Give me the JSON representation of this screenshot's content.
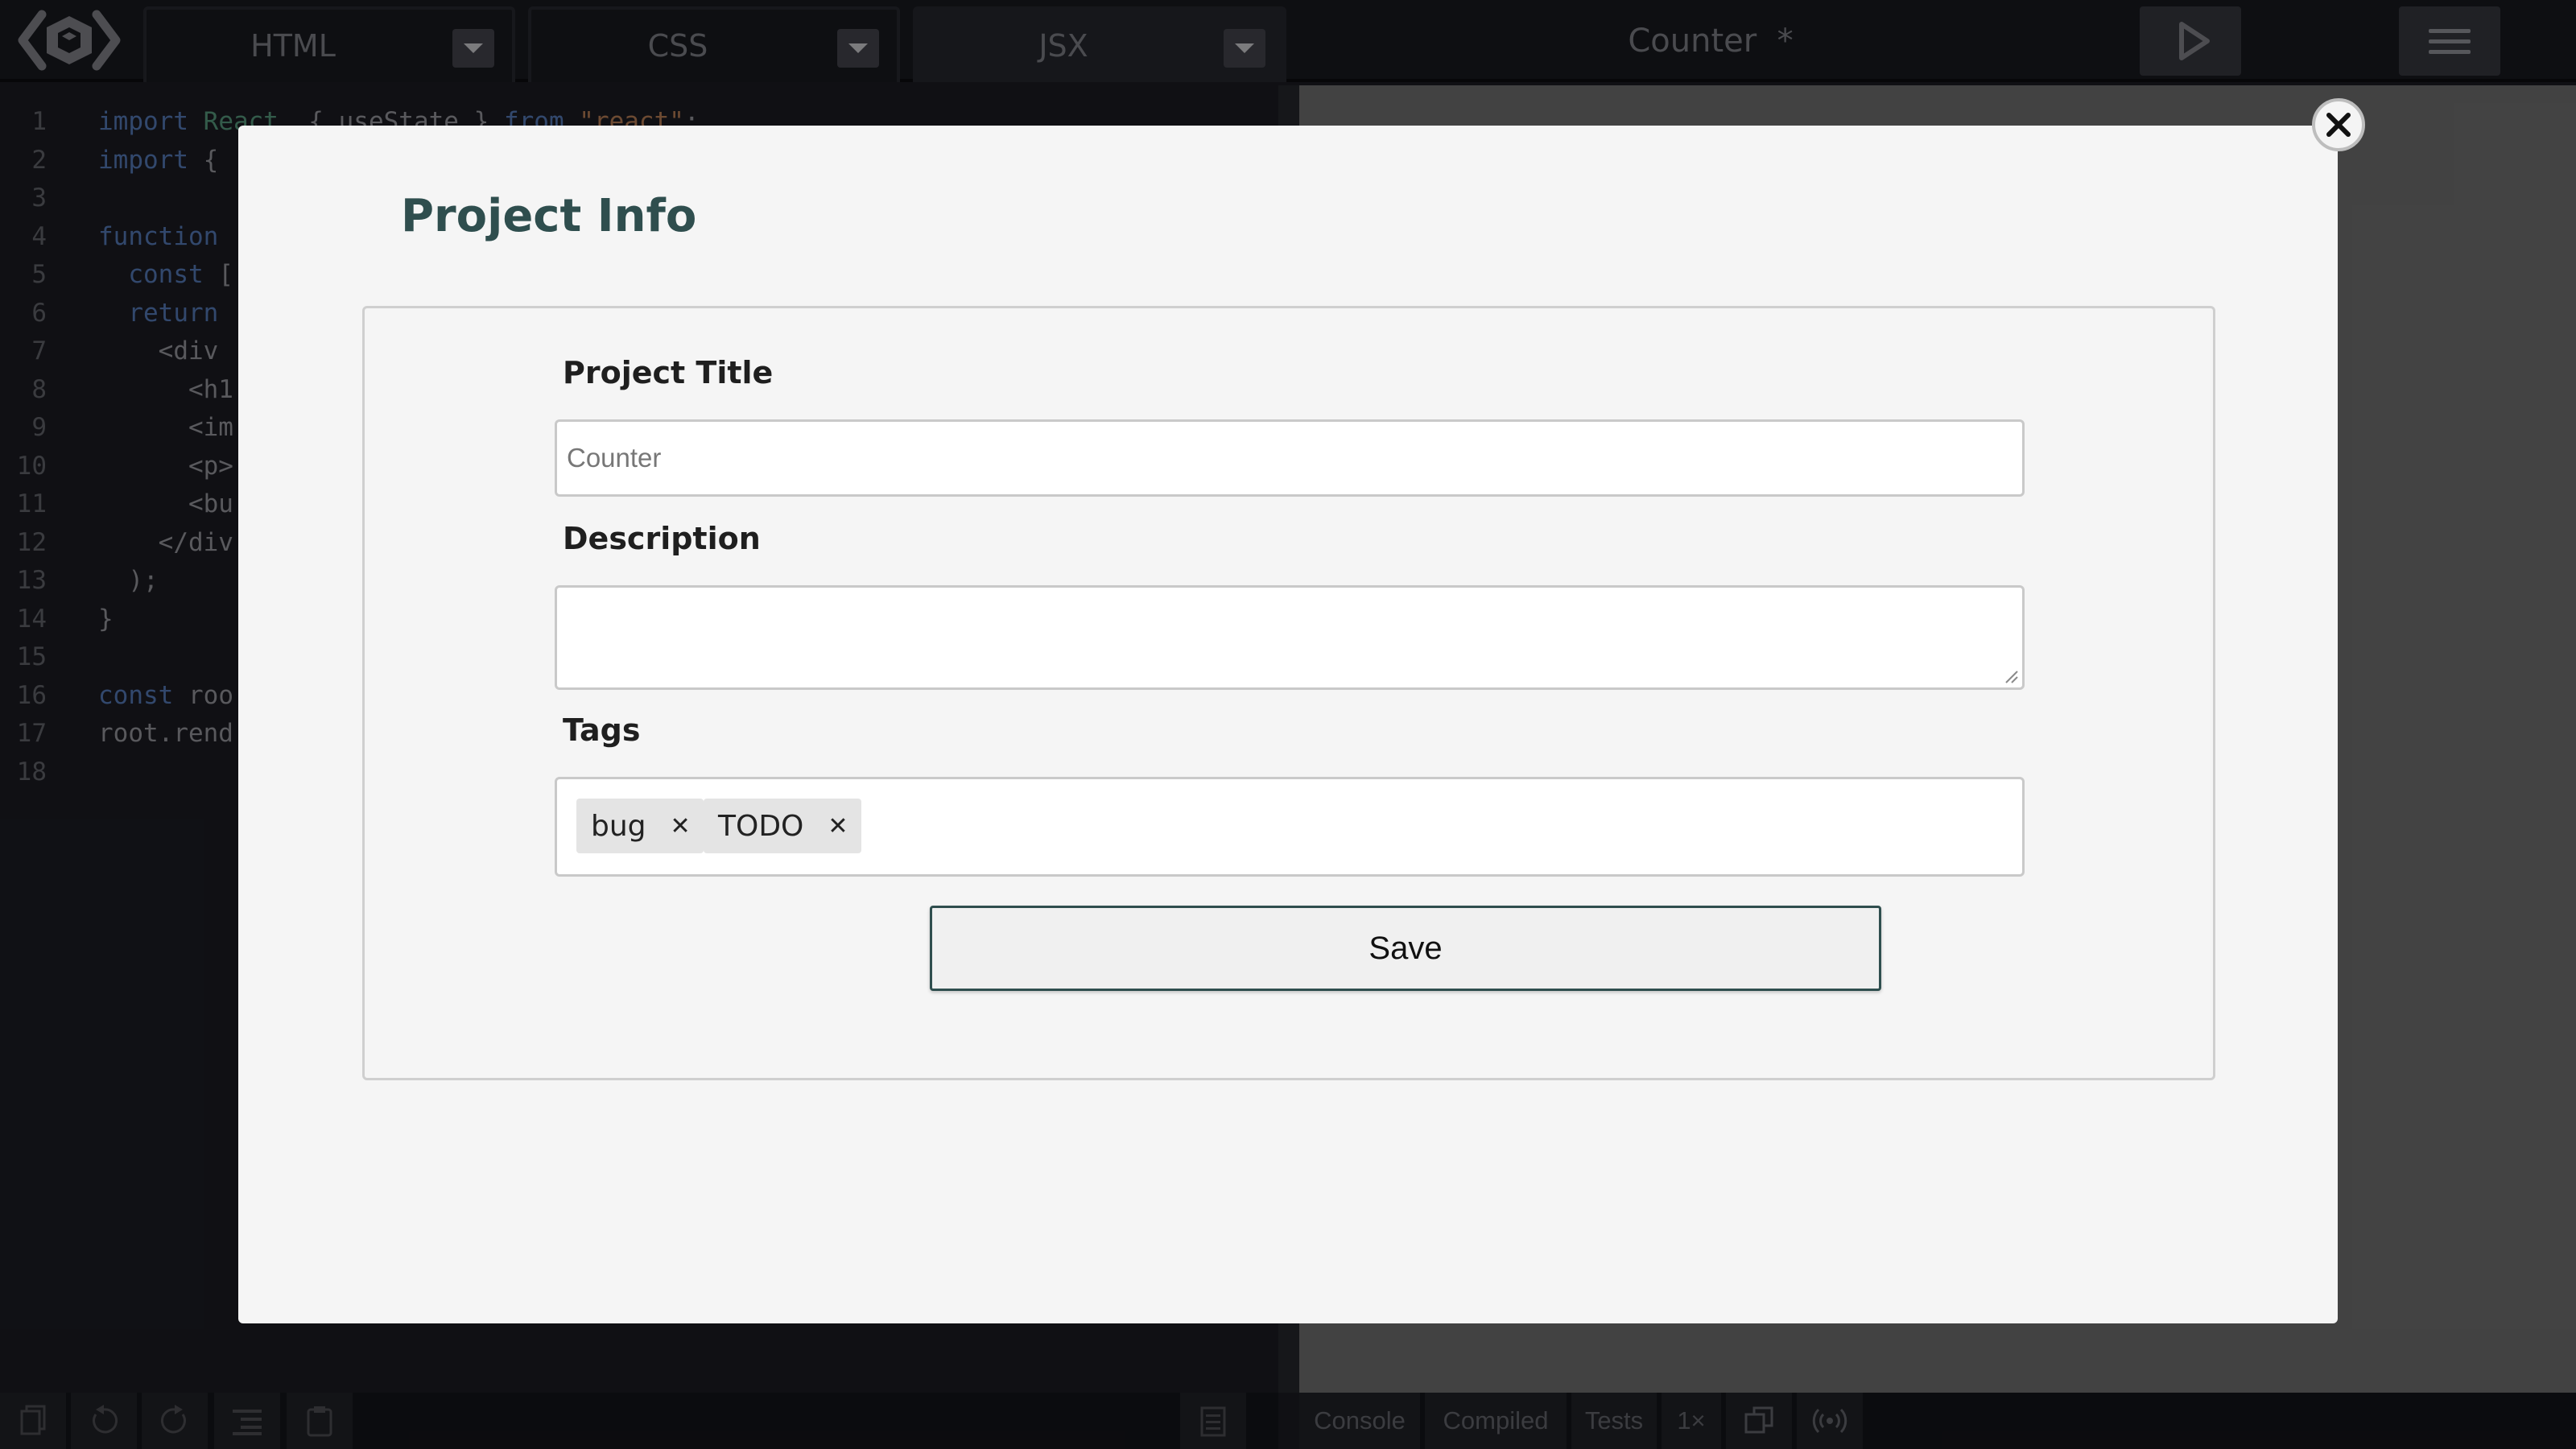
{
  "header": {
    "tabs": [
      {
        "label": "HTML",
        "active": false
      },
      {
        "label": "CSS",
        "active": false
      },
      {
        "label": "JSX",
        "active": true
      }
    ],
    "project_title": "Counter  *",
    "run_icon": "play-icon",
    "menu_icon": "hamburger-menu-icon"
  },
  "editor": {
    "lines": [
      {
        "n": "1",
        "segments": [
          {
            "t": "import",
            "c": "kw"
          },
          {
            "t": " ",
            "c": ""
          },
          {
            "t": "React",
            "c": "id"
          },
          {
            "t": ", { useState } ",
            "c": ""
          },
          {
            "t": "from",
            "c": "kw"
          },
          {
            "t": " ",
            "c": ""
          },
          {
            "t": "\"react\"",
            "c": "str"
          },
          {
            "t": ";",
            "c": ""
          }
        ]
      },
      {
        "n": "2",
        "segments": [
          {
            "t": "import",
            "c": "kw"
          },
          {
            "t": " {",
            "c": ""
          }
        ]
      },
      {
        "n": "3",
        "segments": []
      },
      {
        "n": "4",
        "segments": [
          {
            "t": "function",
            "c": "kw"
          }
        ]
      },
      {
        "n": "5",
        "segments": [
          {
            "t": "  ",
            "c": ""
          },
          {
            "t": "const",
            "c": "kw"
          },
          {
            "t": " [",
            "c": ""
          }
        ]
      },
      {
        "n": "6",
        "segments": [
          {
            "t": "  ",
            "c": ""
          },
          {
            "t": "return",
            "c": "kw"
          }
        ]
      },
      {
        "n": "7",
        "segments": [
          {
            "t": "    <div",
            "c": ""
          }
        ]
      },
      {
        "n": "8",
        "segments": [
          {
            "t": "      <h1",
            "c": ""
          }
        ]
      },
      {
        "n": "9",
        "segments": [
          {
            "t": "      <im",
            "c": ""
          }
        ]
      },
      {
        "n": "10",
        "segments": [
          {
            "t": "      <p>",
            "c": ""
          }
        ]
      },
      {
        "n": "11",
        "segments": [
          {
            "t": "      <bu",
            "c": ""
          }
        ]
      },
      {
        "n": "12",
        "segments": [
          {
            "t": "    </div",
            "c": ""
          }
        ]
      },
      {
        "n": "13",
        "segments": [
          {
            "t": "  );",
            "c": ""
          }
        ]
      },
      {
        "n": "14",
        "segments": [
          {
            "t": "}",
            "c": ""
          }
        ]
      },
      {
        "n": "15",
        "segments": []
      },
      {
        "n": "16",
        "segments": [
          {
            "t": "const",
            "c": "kw"
          },
          {
            "t": " roo",
            "c": ""
          }
        ]
      },
      {
        "n": "17",
        "segments": [
          {
            "t": "root.rend",
            "c": ""
          }
        ]
      },
      {
        "n": "18",
        "segments": []
      }
    ]
  },
  "bottom_left": {
    "icons": [
      "copy-icon",
      "undo-icon",
      "redo-icon",
      "format-icon",
      "clipboard-icon",
      "notes-icon"
    ]
  },
  "bottom_right": {
    "tabs": [
      "Console",
      "Compiled",
      "Tests",
      "1×"
    ],
    "icons": [
      "popout-icon",
      "broadcast-icon"
    ]
  },
  "modal": {
    "title": "Project Info",
    "title_field": {
      "label": "Project Title",
      "value": "",
      "placeholder": "Counter"
    },
    "description_field": {
      "label": "Description",
      "value": ""
    },
    "tags_field": {
      "label": "Tags",
      "tags": [
        "bug",
        "TODO"
      ]
    },
    "save_label": "Save",
    "close_icon": "close-icon"
  },
  "colors": {
    "accent": "#2f4e4e",
    "keyword": "#5d86c9",
    "identifier": "#5fa88a",
    "string": "#c98a5d"
  }
}
